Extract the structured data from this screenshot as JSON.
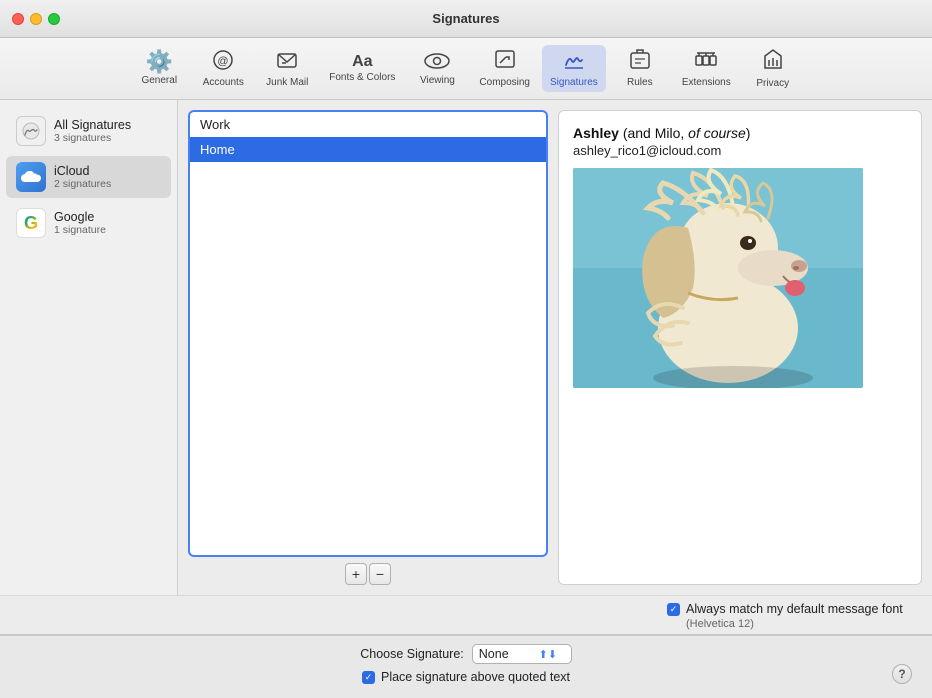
{
  "window": {
    "title": "Signatures"
  },
  "toolbar": {
    "items": [
      {
        "id": "general",
        "label": "General",
        "icon": "⚙️"
      },
      {
        "id": "accounts",
        "label": "Accounts",
        "icon": "✉️"
      },
      {
        "id": "junk-mail",
        "label": "Junk Mail",
        "icon": "🗂️"
      },
      {
        "id": "fonts-colors",
        "label": "Fonts & Colors",
        "icon": "Aa"
      },
      {
        "id": "viewing",
        "label": "Viewing",
        "icon": "👓"
      },
      {
        "id": "composing",
        "label": "Composing",
        "icon": "✏️"
      },
      {
        "id": "signatures",
        "label": "Signatures",
        "icon": "✍️"
      },
      {
        "id": "rules",
        "label": "Rules",
        "icon": "📥"
      },
      {
        "id": "extensions",
        "label": "Extensions",
        "icon": "🧩"
      },
      {
        "id": "privacy",
        "label": "Privacy",
        "icon": "🖐️"
      }
    ]
  },
  "sidebar": {
    "items": [
      {
        "id": "all-signatures",
        "name": "All Signatures",
        "count": "3 signatures",
        "iconType": "all"
      },
      {
        "id": "icloud",
        "name": "iCloud",
        "count": "2 signatures",
        "iconType": "icloud"
      },
      {
        "id": "google",
        "name": "Google",
        "count": "1 signature",
        "iconType": "google"
      }
    ]
  },
  "signature_list": {
    "items": [
      {
        "id": "work",
        "label": "Work",
        "selected": false
      },
      {
        "id": "home",
        "label": "Home",
        "selected": true
      }
    ]
  },
  "signature_controls": {
    "add_label": "+",
    "remove_label": "−"
  },
  "preview": {
    "name_html": "Ashley (and Milo, of course)",
    "name_bold": "Ashley",
    "name_rest": " (and Milo, ",
    "name_italic": "of course",
    "name_end": ")",
    "email": "ashley_rico1@icloud.com"
  },
  "bottom_bar": {
    "font_match_label": "Always match my default message font",
    "font_hint": "(Helvetica 12)",
    "choose_sig_label": "Choose Signature:",
    "sig_dropdown_value": "None",
    "place_sig_label": "Place signature above quoted text"
  }
}
